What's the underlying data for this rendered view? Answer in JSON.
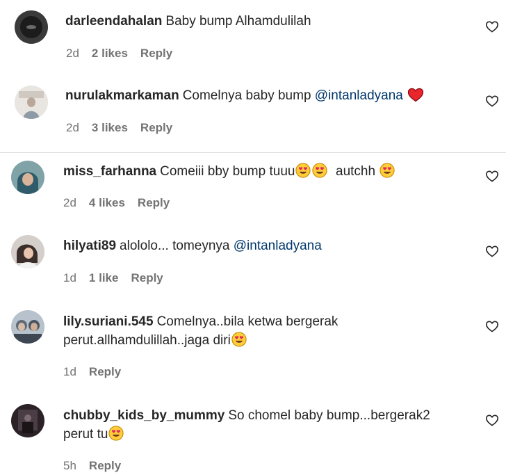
{
  "comments": [
    {
      "username": "darleendahalan",
      "text": "Baby bump Alhamdulilah",
      "time": "2d",
      "likes": "2 likes",
      "reply": "Reply"
    },
    {
      "username": "nurulakmarkaman",
      "text": "Comelnya baby bump",
      "mention": "@intanladyana",
      "time": "2d",
      "likes": "3 likes",
      "reply": "Reply"
    },
    {
      "username": "miss_farhanna",
      "text": "Comeiii bby bump tuuu",
      "text2": "autchh",
      "time": "2d",
      "likes": "4 likes",
      "reply": "Reply"
    },
    {
      "username": "hilyati89",
      "text": "alololo... tomeynya",
      "mention": "@intanladyana",
      "time": "1d",
      "likes": "1 like",
      "reply": "Reply"
    },
    {
      "username": "lily.suriani.545",
      "text": "Comelnya..bila ketwa bergerak",
      "text2": "perut.allhamdulillah..jaga diri",
      "time": "1d",
      "reply": "Reply"
    },
    {
      "username": "chubby_kids_by_mummy",
      "text": "So chomel baby bump...bergerak2",
      "text2": "perut tu",
      "time": "5h",
      "reply": "Reply"
    }
  ],
  "icons": {
    "heart": "heart-outline-icon",
    "red_heart": "red-heart-emoji",
    "heart_eyes": "heart-eyes-emoji"
  },
  "colors": {
    "text": "#262626",
    "meta": "#737373",
    "mention": "#00376b",
    "divider": "#dbdbdb"
  }
}
